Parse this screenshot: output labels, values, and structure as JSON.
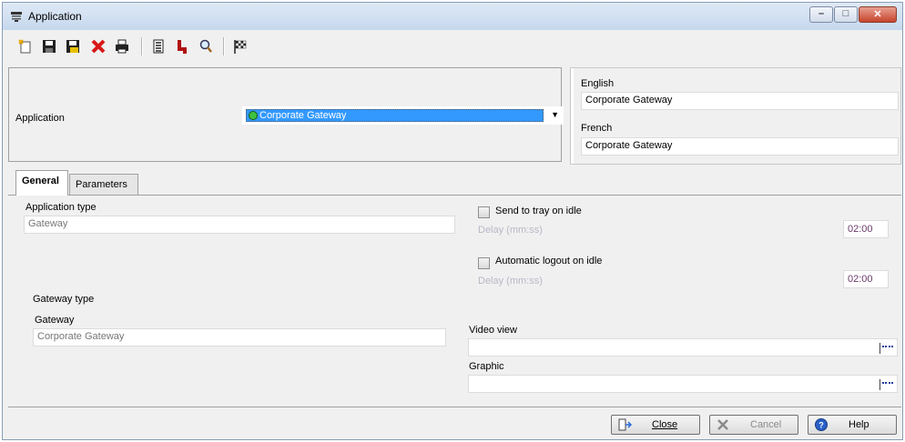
{
  "window": {
    "title": "Application"
  },
  "toolbar": {
    "buttons": [
      "new-icon",
      "save-icon",
      "save-as-icon",
      "delete-icon",
      "print-icon",
      "list-icon",
      "link-icon",
      "search-icon",
      "finish-flag-icon"
    ]
  },
  "application": {
    "label": "Application",
    "selected": "Corporate Gateway"
  },
  "translations": {
    "english_label": "English",
    "english_value": "Corporate Gateway",
    "french_label": "French",
    "french_value": "Corporate Gateway"
  },
  "tabs": [
    {
      "label": "General",
      "active": true
    },
    {
      "label": "Parameters",
      "active": false
    }
  ],
  "general": {
    "app_type_label": "Application type",
    "app_type_value": "Gateway",
    "gateway_type_label": "Gateway type",
    "gateway_label": "Gateway",
    "gateway_value": "Corporate Gateway",
    "tray_label": "Send to tray on idle",
    "tray_checked": false,
    "tray_delay_label": "Delay (mm:ss)",
    "tray_delay_value": "02:00",
    "logout_label": "Automatic logout on idle",
    "logout_checked": false,
    "logout_delay_label": "Delay (mm:ss)",
    "logout_delay_value": "02:00",
    "video_view_label": "Video view",
    "video_view_value": "",
    "graphic_label": "Graphic",
    "graphic_value": ""
  },
  "buttons": {
    "close": "Close",
    "cancel": "Cancel",
    "help": "Help"
  },
  "colors": {
    "selection": "#3399ff",
    "status_dot": "#3fc23f",
    "browse": "#1e3c9c"
  }
}
